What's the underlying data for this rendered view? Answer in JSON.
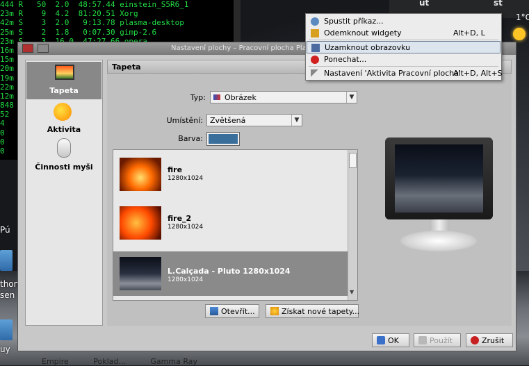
{
  "terminal": {
    "lines": [
      "444 R   50  2.0  48:57.44 einstein_S5R6_1",
      "23m R    9  4.2  81:20.51 Xorg",
      "42m S    3  2.0   9:13.78 plasma-desktop",
      "25m S    2  1.8   0:07.30 gimp-2.6",
      "23m S    3  16.0  47:27.66 opera",
      "16m",
      "15m",
      "20m",
      "19m",
      "22m",
      "12m",
      "848",
      "52",
      "4",
      "0",
      "0",
      "0"
    ]
  },
  "panel": {
    "day1": "út",
    "day2": "st",
    "temperature": "1°C"
  },
  "desktop": {
    "label_p": "Pú",
    "label_thon": "thon",
    "label_sen": "sen",
    "label_uy": "uy",
    "taskbar": [
      "Empire",
      "Poklad...",
      "Gamma Ray"
    ]
  },
  "dialog": {
    "title": "Nastavení plochy – Pracovní plocha Plasma",
    "sidebar": [
      {
        "label": "Tapeta"
      },
      {
        "label": "Aktivita"
      },
      {
        "label": "Činnosti myši"
      }
    ],
    "section_title": "Tapeta",
    "type_label": "Typ:",
    "type_value": "Obrázek",
    "position_label": "Umístění:",
    "position_value": "Zvětšená",
    "color_label": "Barva:",
    "color_value": "#3a6f9c",
    "wallpapers": [
      {
        "name": "fire",
        "size": "1280x1024"
      },
      {
        "name": "fire_2",
        "size": "1280x1024"
      },
      {
        "name": "L.Calçada - Pluto 1280x1024",
        "size": "1280x1024"
      }
    ],
    "open_button": "Otevřít...",
    "get_new_button": "Získat nové tapety...",
    "ok_button": "OK",
    "apply_button": "Použít",
    "cancel_button": "Zrušit"
  },
  "context_menu": {
    "items": [
      {
        "label": "Spustit příkaz...",
        "shortcut": ""
      },
      {
        "label": "Odemknout widgety",
        "shortcut": "Alt+D, L"
      },
      {
        "label": "Uzamknout obrazovku",
        "shortcut": ""
      },
      {
        "label": "Ponechat...",
        "shortcut": ""
      },
      {
        "label": "Nastavení 'Aktivita Pracovní plocha'",
        "shortcut": "Alt+D, Alt+S"
      }
    ]
  }
}
